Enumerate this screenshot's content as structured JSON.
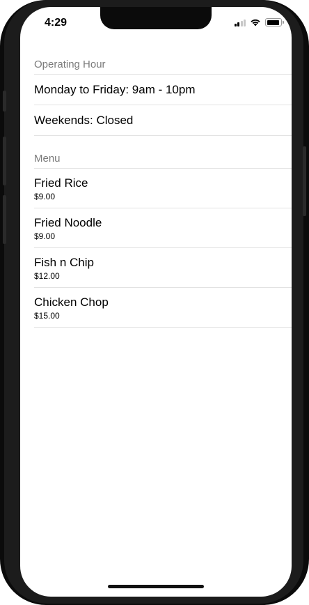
{
  "status_bar": {
    "time": "4:29",
    "icons": [
      "signal-icon",
      "wifi-icon",
      "battery-icon"
    ],
    "battery_level": 0.9
  },
  "operating_hours": {
    "header": "Operating Hour",
    "rows": [
      {
        "label": "Monday to Friday: 9am - 10pm"
      },
      {
        "label": "Weekends: Closed"
      }
    ]
  },
  "menu": {
    "header": "Menu",
    "items": [
      {
        "name": "Fried Rice",
        "price": "$9.00"
      },
      {
        "name": "Fried Noodle",
        "price": "$9.00"
      },
      {
        "name": "Fish n Chip",
        "price": "$12.00"
      },
      {
        "name": "Chicken Chop",
        "price": "$15.00"
      }
    ]
  },
  "colors": {
    "section_header": "#7a7a7a",
    "separator": "#e2e2e2",
    "text": "#000000",
    "background": "#ffffff"
  }
}
